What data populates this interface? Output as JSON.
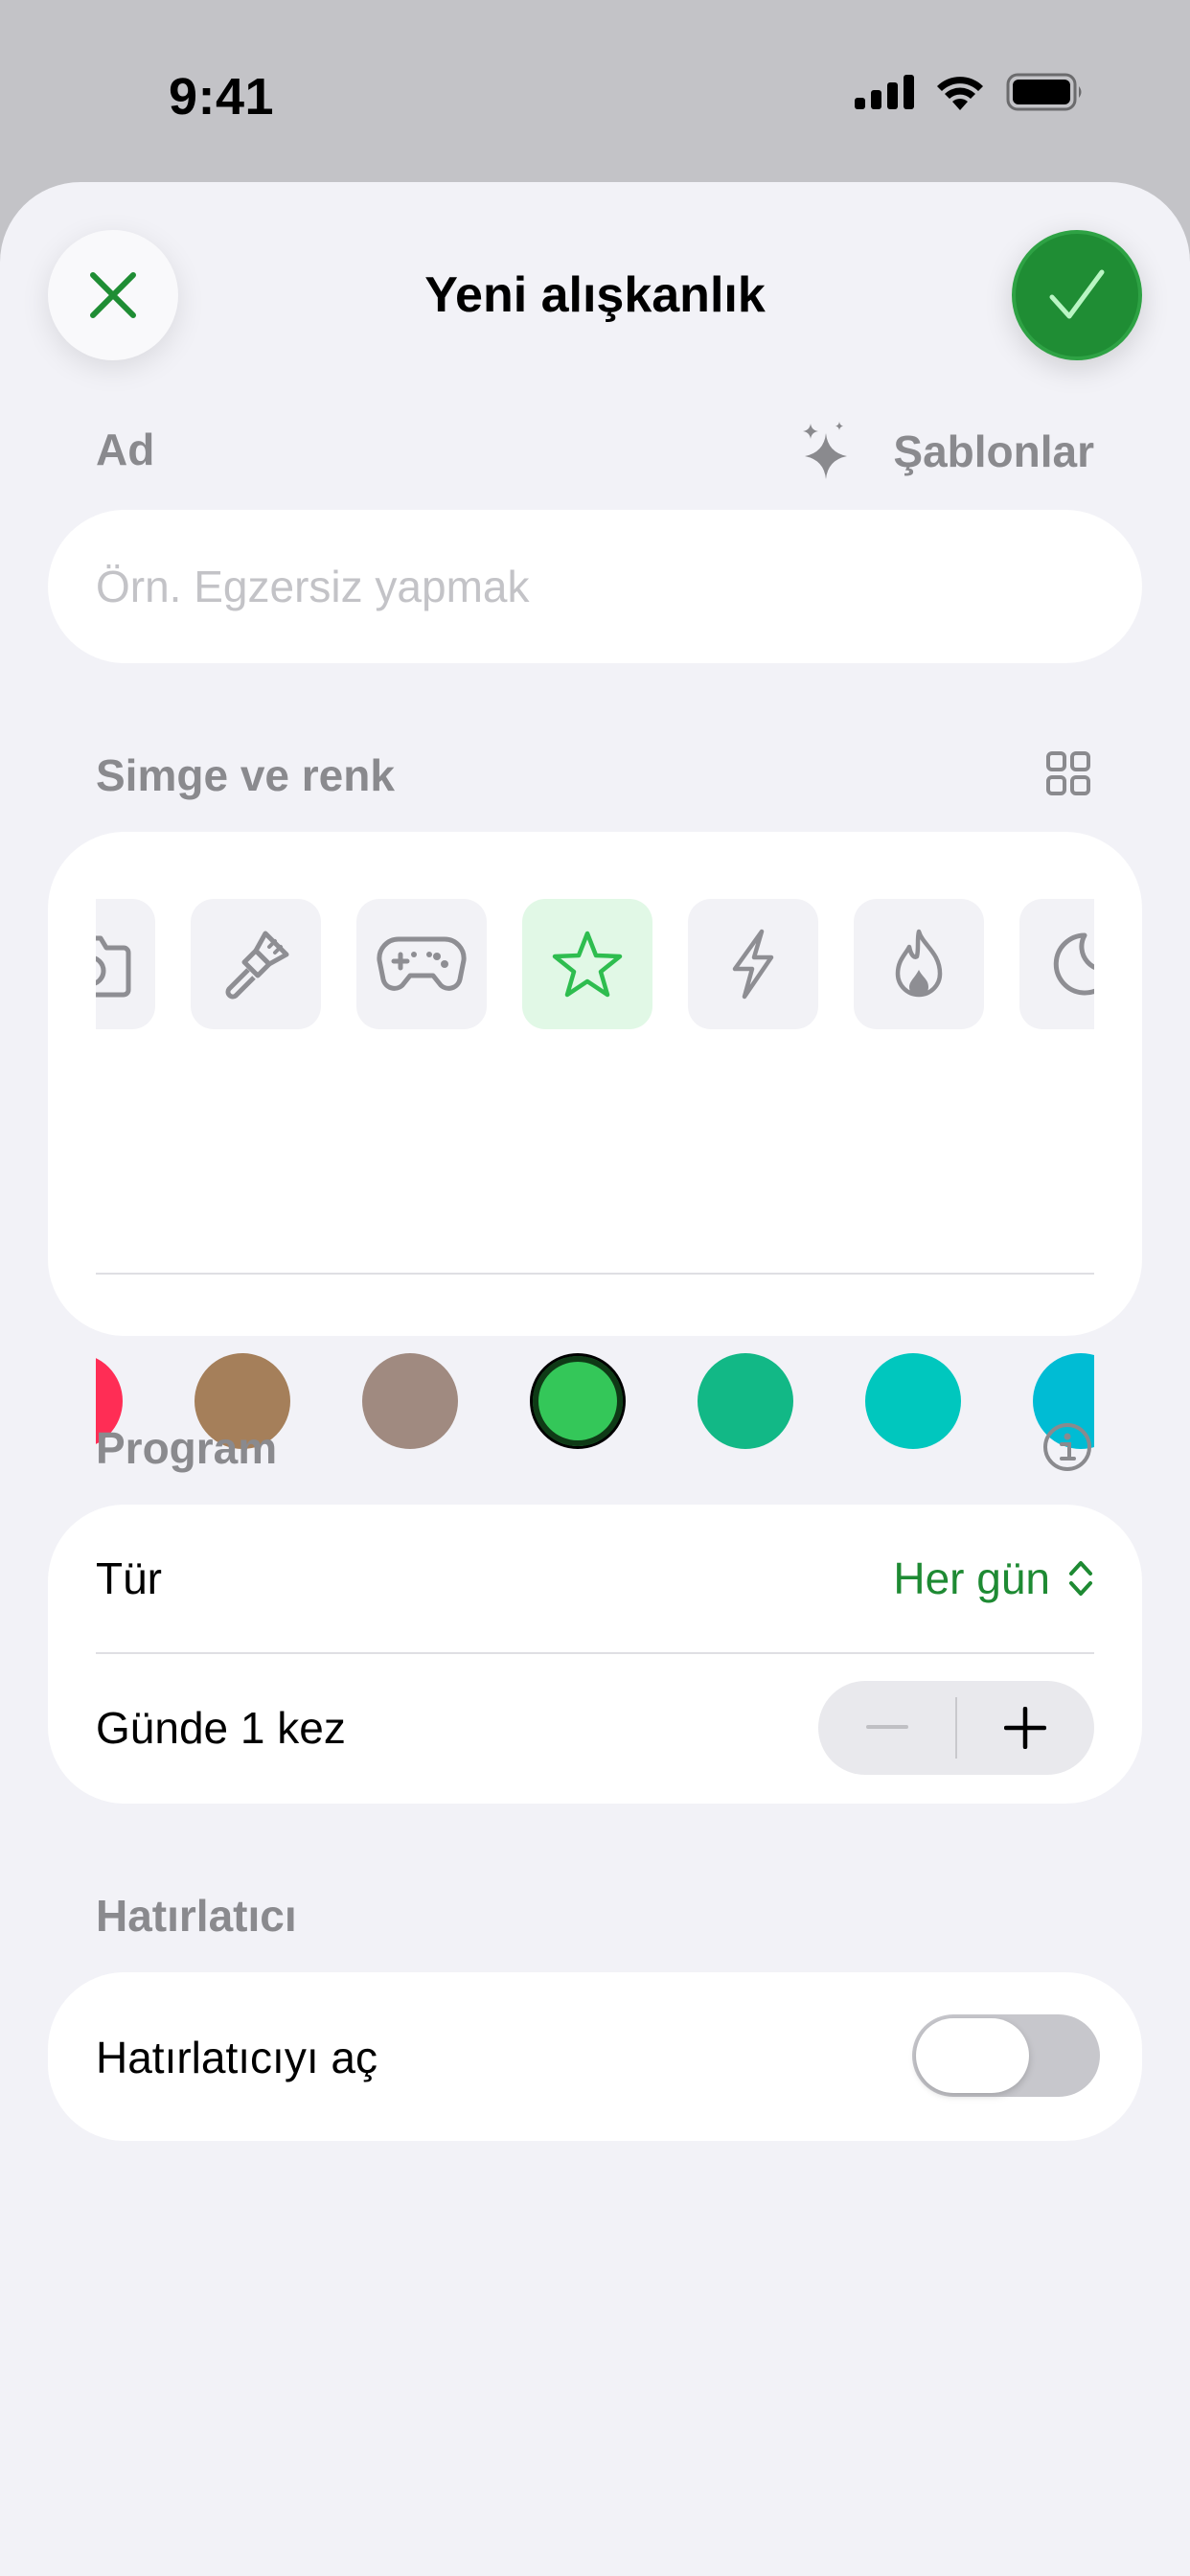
{
  "status_bar": {
    "time": "9:41"
  },
  "nav": {
    "title": "Yeni alışkanlık"
  },
  "name_section": {
    "label": "Ad",
    "templates_label": "Şablonlar",
    "placeholder": "Örn. Egzersiz yapmak",
    "value": ""
  },
  "icon_section": {
    "label": "Simge ve renk",
    "icons": [
      "camera-icon",
      "paintbrush-icon",
      "gamecontroller-icon",
      "star-icon",
      "bolt-icon",
      "flame-icon",
      "moon-icon"
    ],
    "selected_icon": "star-icon",
    "colors": [
      "#ff2d55",
      "#a57f5a",
      "#a08a80",
      "#34c759",
      "#12b886",
      "#00c7be",
      "#00bcd4"
    ],
    "selected_color": "#34c759"
  },
  "program_section": {
    "label": "Program",
    "type_label": "Tür",
    "type_value": "Her gün",
    "frequency_label": "Günde 1 kez",
    "frequency_count": 1
  },
  "reminder_section": {
    "label": "Hatırlatıcı",
    "toggle_label": "Hatırlatıcıyı aç",
    "toggle_on": false
  },
  "colors": {
    "accent": "#1f8d34",
    "accent_text": "#1e8a33",
    "background": "#f2f2f7"
  }
}
